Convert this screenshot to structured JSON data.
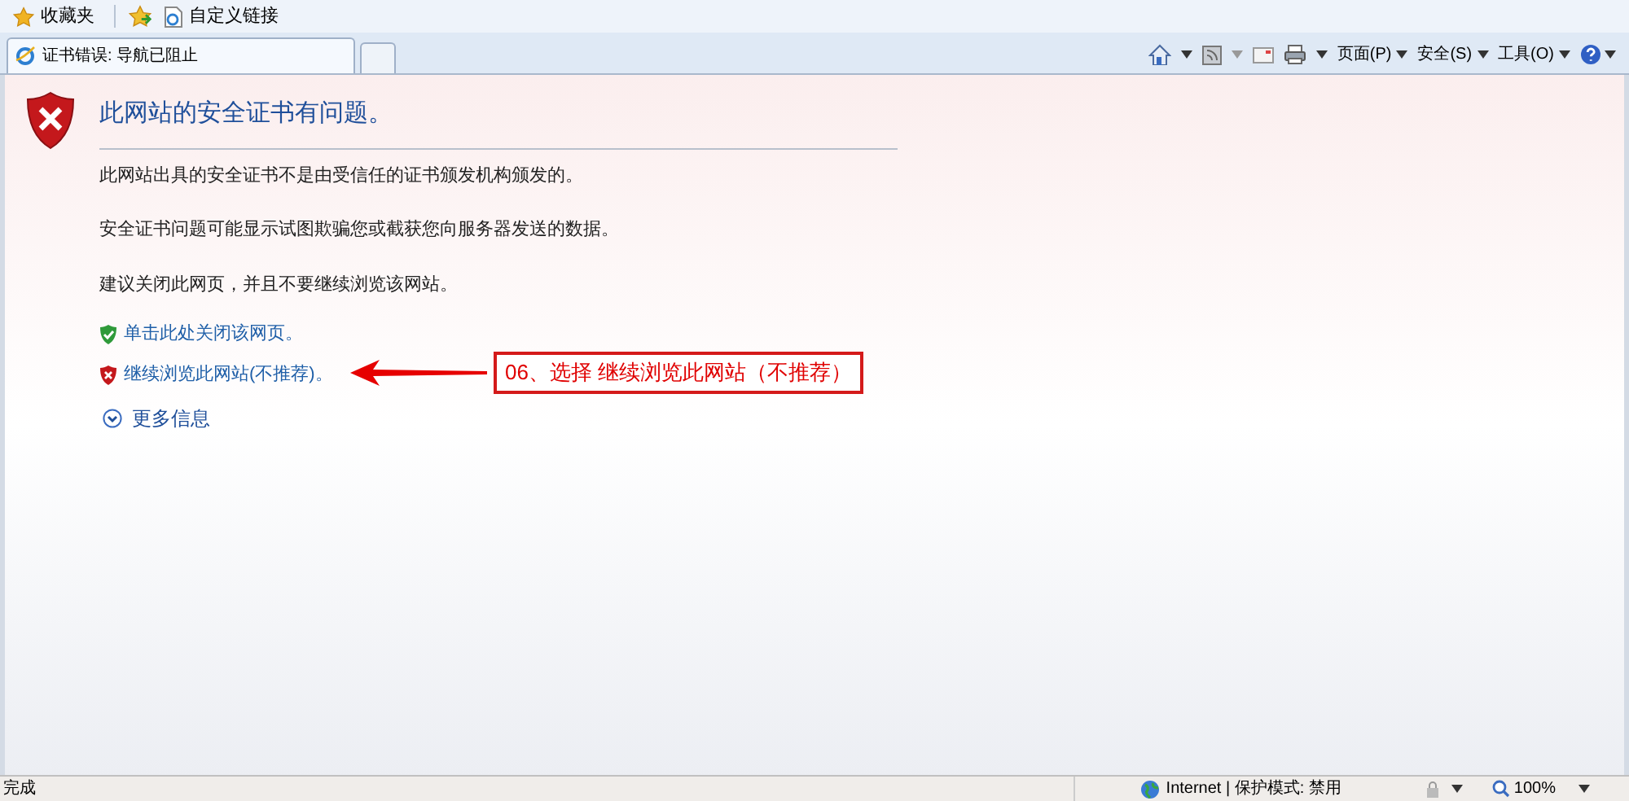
{
  "favorites_bar": {
    "favorites": "收藏夹",
    "links": [
      "自定义链接"
    ]
  },
  "tabs": [
    {
      "label": "证书错误: 导航已阻止",
      "selected": true
    }
  ],
  "command_bar": {
    "menus": [
      "页面(P)",
      "安全(S)",
      "工具(O)"
    ]
  },
  "page": {
    "title": "此网站的安全证书有问题。",
    "paragraphs": [
      "此网站出具的安全证书不是由受信任的证书颁发机构颁发的。",
      "安全证书问题可能显示试图欺骗您或截获您向服务器发送的数据。",
      "建议关闭此网页，并且不要继续浏览该网站。"
    ],
    "links": [
      {
        "kind": "safe",
        "label": "单击此处关闭该网页。"
      },
      {
        "kind": "unsafe",
        "label": "继续浏览此网站(不推荐)。"
      },
      {
        "kind": "more",
        "label": "更多信息"
      }
    ],
    "annotation": "06、选择 继续浏览此网站（不推荐）"
  },
  "status_bar": {
    "status": "完成",
    "zone": "Internet | 保护模式: 禁用",
    "zoom": "100%"
  }
}
